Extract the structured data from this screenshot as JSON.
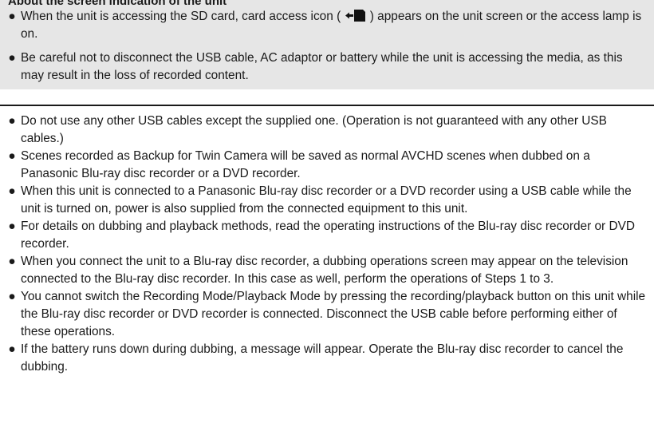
{
  "note_box": {
    "title": "About the screen indication of the unit",
    "items": [
      {
        "text_before_icon": "When the unit is accessing the SD card, card access icon ( ",
        "icon": "card-access-icon",
        "text_after_icon": " ) appears on the unit screen or the access lamp is on."
      },
      {
        "text": "Be careful not to disconnect the USB cable, AC adaptor or battery while the unit is accessing the media, as this may result in the loss of recorded content."
      }
    ]
  },
  "notes": [
    "Do not use any other USB cables except the supplied one. (Operation is not guaranteed with any other USB cables.)",
    "Scenes recorded as Backup for Twin Camera will be saved as normal AVCHD scenes when dubbed on a Panasonic Blu-ray disc recorder or a DVD recorder.",
    "When this unit is connected to a Panasonic Blu-ray disc recorder or a DVD recorder using a USB cable while the unit is turned on, power is also supplied from the connected equipment to this unit.",
    "For details on dubbing and playback methods, read the operating instructions of the Blu-ray disc recorder or DVD recorder.",
    "When you connect the unit to a Blu-ray disc recorder, a dubbing operations screen may appear on the television connected to the Blu-ray disc recorder. In this case as well, perform the operations of Steps 1 to 3.",
    "You cannot switch the Recording Mode/Playback Mode by pressing the recording/playback button on this unit while the Blu-ray disc recorder or DVD recorder is connected. Disconnect the USB cable before performing either of these operations.",
    "If the battery runs down during dubbing, a message will appear. Operate the Blu-ray disc recorder to cancel the dubbing."
  ],
  "bullet_symbol": "●"
}
